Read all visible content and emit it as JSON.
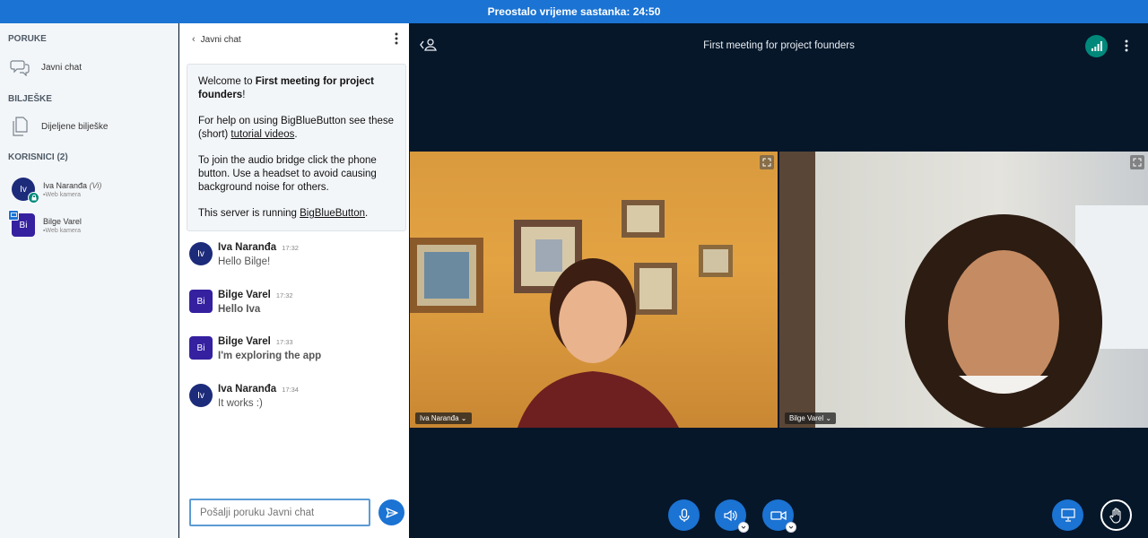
{
  "topbar": {
    "text": "Preostalo vrijeme sastanka: 24:50"
  },
  "sidebar": {
    "messages_title": "PORUKE",
    "public_chat": "Javni chat",
    "notes_title": "BILJEŠKE",
    "shared_notes": "Dijeljene bilješke",
    "users_title": "KORISNICI (2)",
    "users": [
      {
        "initials": "Iv",
        "name": "Iva Naranđa",
        "role": "(Vi)",
        "status": "Web kamera",
        "color": "#1c2b7a"
      },
      {
        "initials": "Bi",
        "name": "Bilge Varel",
        "status": "Web kamera",
        "color": "#3520a0"
      }
    ]
  },
  "chat": {
    "header": "Javni chat",
    "welcome": {
      "l1a": "Welcome to ",
      "l1b": "First meeting for project founders",
      "l1c": "!",
      "l2a": "For help on using BigBlueButton see these (short) ",
      "l2b": "tutorial videos",
      "l2c": ".",
      "l3": "To join the audio bridge click the phone button. Use a headset to avoid causing background noise for others.",
      "l4a": "This server is running ",
      "l4b": "BigBlueButton",
      "l4c": "."
    },
    "messages": [
      {
        "initials": "Iv",
        "name": "Iva Naranđa",
        "time": "17:32",
        "text": "Hello Bilge!"
      },
      {
        "initials": "Bi",
        "name": "Bilge Varel",
        "time": "17:32",
        "text": "Hello Iva"
      },
      {
        "initials": "Bi",
        "name": "Bilge Varel",
        "time": "17:33",
        "text": "I'm exploring the app"
      },
      {
        "initials": "Iv",
        "name": "Iva Naranđa",
        "time": "17:34",
        "text": "It works :)"
      }
    ],
    "input_placeholder": "Pošalji poruku Javni chat"
  },
  "main": {
    "title": "First meeting for project founders",
    "videos": [
      {
        "label": "Iva Naranđa ⌄"
      },
      {
        "label": "Bilge Varel ⌄"
      }
    ]
  },
  "colors": {
    "accent": "#1b73d3",
    "dark_bg": "#06172a",
    "status_green": "#00897b"
  }
}
